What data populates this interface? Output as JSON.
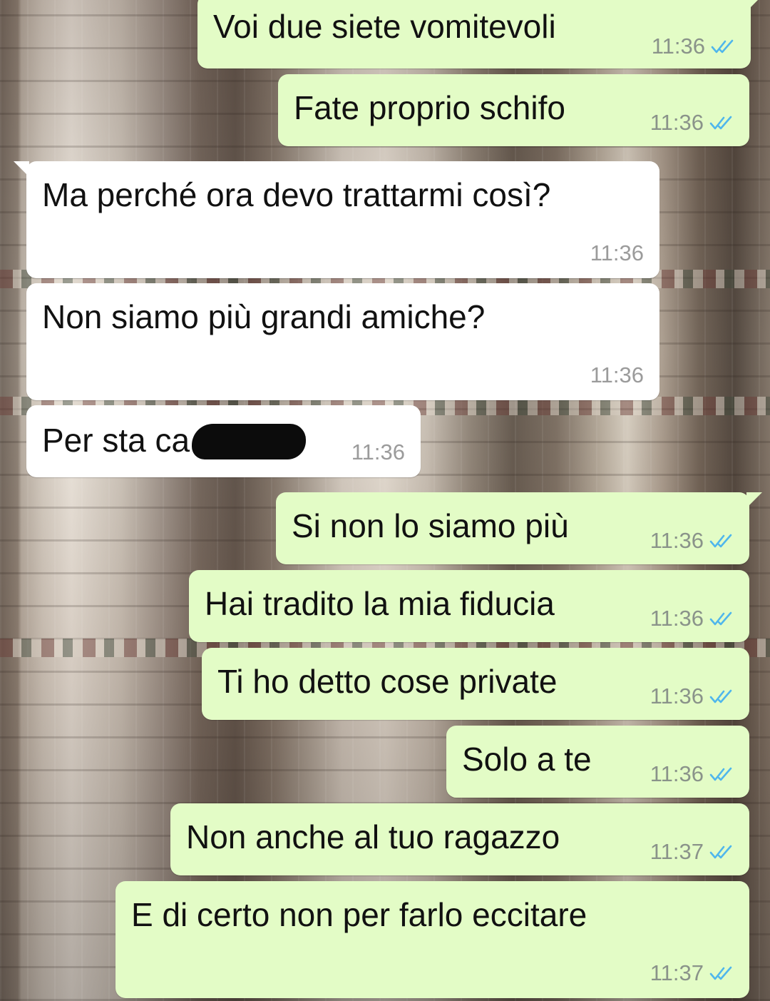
{
  "chat": {
    "messages": [
      {
        "direction": "outgoing",
        "text": "Voi due siete vomitevoli",
        "time": "11:36",
        "status_icon": "double-check-read-icon"
      },
      {
        "direction": "outgoing",
        "text": "Fate proprio schifo",
        "time": "11:36",
        "status_icon": "double-check-read-icon"
      },
      {
        "direction": "incoming",
        "text": "Ma perché ora devo trattarmi così?",
        "time": "11:36"
      },
      {
        "direction": "incoming",
        "text": "Non siamo più grandi amiche?",
        "time": "11:36"
      },
      {
        "direction": "incoming",
        "text": "Per sta ca",
        "time": "11:36",
        "redacted": true
      },
      {
        "direction": "outgoing",
        "text": "Si non lo siamo più",
        "time": "11:36",
        "status_icon": "double-check-read-icon"
      },
      {
        "direction": "outgoing",
        "text": "Hai tradito la mia fiducia",
        "time": "11:36",
        "status_icon": "double-check-read-icon"
      },
      {
        "direction": "outgoing",
        "text": "Ti ho detto cose private",
        "time": "11:36",
        "status_icon": "double-check-read-icon"
      },
      {
        "direction": "outgoing",
        "text": "Solo a te",
        "time": "11:36",
        "status_icon": "double-check-read-icon"
      },
      {
        "direction": "outgoing",
        "text": "Non anche al tuo ragazzo",
        "time": "11:37",
        "status_icon": "double-check-read-icon"
      },
      {
        "direction": "outgoing",
        "text": "E di certo non per farlo eccitare",
        "time": "11:37",
        "status_icon": "double-check-read-icon"
      }
    ]
  },
  "colors": {
    "outgoing_bubble": "#e3fcc6",
    "incoming_bubble": "#ffffff",
    "read_ticks": "#4fb6ec",
    "timestamp": "#8a938a"
  }
}
